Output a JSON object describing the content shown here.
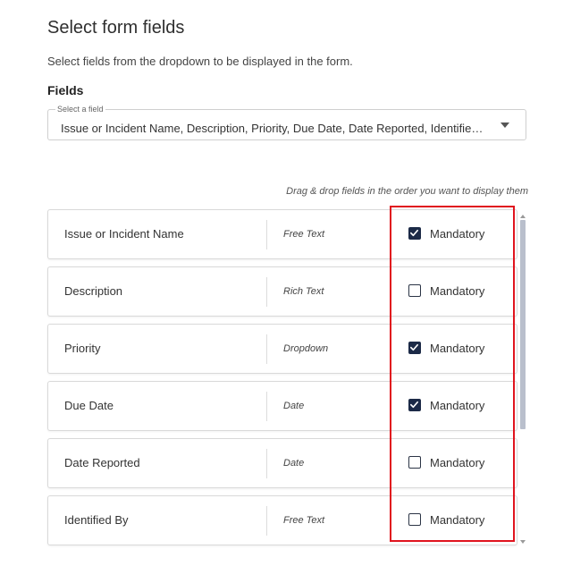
{
  "page": {
    "title": "Select form fields",
    "subtitle": "Select fields from the dropdown to be displayed in the form."
  },
  "fields_section": {
    "label": "Fields",
    "select": {
      "legend": "Select a field",
      "value": "Issue or Incident Name, Description, Priority, Due Date, Date Reported, Identified By, ..."
    },
    "drag_hint": "Drag & drop fields in the order you want to display them"
  },
  "rows": [
    {
      "name": "Issue or Incident Name",
      "type": "Free Text",
      "mandatory_label": "Mandatory",
      "checked": true
    },
    {
      "name": "Description",
      "type": "Rich Text",
      "mandatory_label": "Mandatory",
      "checked": false
    },
    {
      "name": "Priority",
      "type": "Dropdown",
      "mandatory_label": "Mandatory",
      "checked": true
    },
    {
      "name": "Due Date",
      "type": "Date",
      "mandatory_label": "Mandatory",
      "checked": true
    },
    {
      "name": "Date Reported",
      "type": "Date",
      "mandatory_label": "Mandatory",
      "checked": false
    },
    {
      "name": "Identified By",
      "type": "Free Text",
      "mandatory_label": "Mandatory",
      "checked": false
    }
  ],
  "colors": {
    "checkbox_checked": "#1c2a47",
    "highlight": "#e0141e"
  },
  "icons": {
    "dropdown": "chevron-down-icon",
    "check": "checkmark-icon"
  }
}
